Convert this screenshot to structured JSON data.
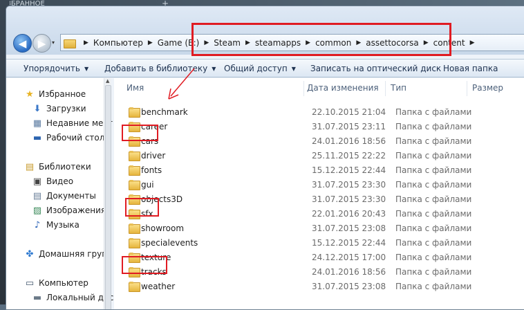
{
  "desktop": {
    "top_text": "ИЗБРАННОЕ",
    "plus": "+"
  },
  "nav": {
    "back": "◀",
    "forward": "▶",
    "dropdown": "▾"
  },
  "breadcrumbs": [
    {
      "label": "Компьютер"
    },
    {
      "label": "Game (E:)"
    },
    {
      "label": "Steam"
    },
    {
      "label": "steamapps"
    },
    {
      "label": "common"
    },
    {
      "label": "assettocorsa"
    },
    {
      "label": "content"
    }
  ],
  "toolbar": {
    "organize": "Упорядочить",
    "add_library": "Добавить в библиотеку",
    "share": "Общий доступ",
    "burn": "Записать на оптический диск",
    "new_folder": "Новая папка"
  },
  "navpane": {
    "favorites": "Избранное",
    "downloads": "Загрузки",
    "recent": "Недавние мест",
    "desktop": "Рабочий стол",
    "libraries": "Библиотеки",
    "video": "Видео",
    "documents": "Документы",
    "images": "Изображения",
    "music": "Музыка",
    "homegroup": "Домашняя груп",
    "computer": "Компьютер",
    "local_disk": "Локальный дис"
  },
  "columns": {
    "name": "Имя",
    "date": "Дата изменения",
    "type": "Тип",
    "size": "Размер"
  },
  "files": [
    {
      "name": "benchmark",
      "date": "22.10.2015 21:04",
      "type": "Папка с файлами"
    },
    {
      "name": "career",
      "date": "31.07.2015 23:11",
      "type": "Папка с файлами"
    },
    {
      "name": "cars",
      "date": "24.01.2016 18:56",
      "type": "Папка с файлами"
    },
    {
      "name": "driver",
      "date": "25.11.2015 22:22",
      "type": "Папка с файлами"
    },
    {
      "name": "fonts",
      "date": "15.12.2015 22:44",
      "type": "Папка с файлами"
    },
    {
      "name": "gui",
      "date": "31.07.2015 23:30",
      "type": "Папка с файлами"
    },
    {
      "name": "objects3D",
      "date": "31.07.2015 23:30",
      "type": "Папка с файлами"
    },
    {
      "name": "sfx",
      "date": "22.01.2016 20:43",
      "type": "Папка с файлами"
    },
    {
      "name": "showroom",
      "date": "31.07.2015 23:08",
      "type": "Папка с файлами"
    },
    {
      "name": "specialevents",
      "date": "15.12.2015 22:44",
      "type": "Папка с файлами"
    },
    {
      "name": "texture",
      "date": "24.12.2015 17:00",
      "type": "Папка с файлами"
    },
    {
      "name": "tracks",
      "date": "24.01.2016 18:56",
      "type": "Папка с файлами"
    },
    {
      "name": "weather",
      "date": "31.07.2015 23:08",
      "type": "Папка с файлами"
    }
  ],
  "colors": {
    "annotation_red": "#e01b22",
    "accent_blue": "#2a6cc4"
  }
}
